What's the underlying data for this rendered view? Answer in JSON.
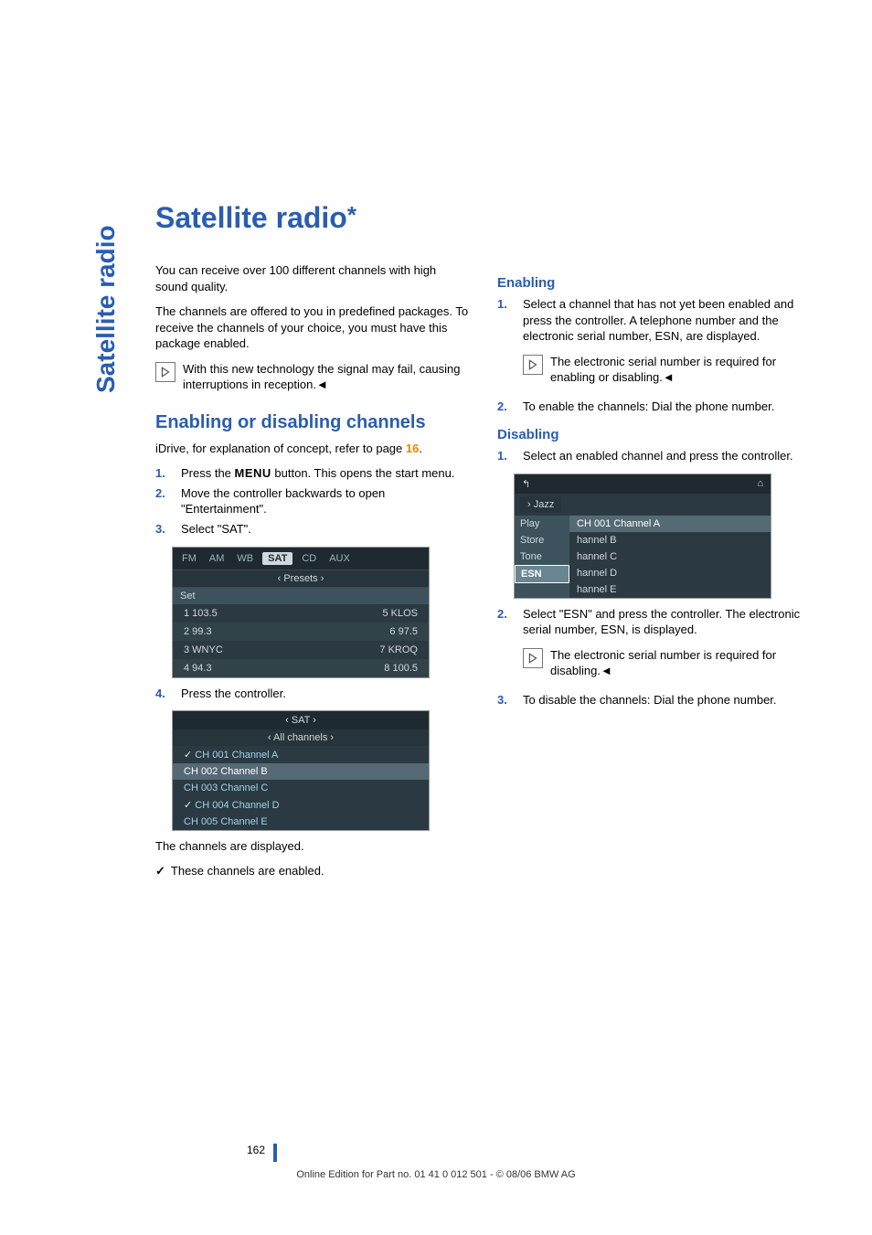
{
  "side_tab": "Satellite radio",
  "title": "Satellite radio",
  "title_suffix": "*",
  "left": {
    "intro1": "You can receive over 100 different channels with high sound quality.",
    "intro2": "The channels are offered to you in predefined packages. To receive the channels of your choice, you must have this package enabled.",
    "note1": "With this new technology the signal may fail, causing interruptions in reception.",
    "section_title": "Enabling or disabling channels",
    "idrive_text_a": "iDrive, for explanation of concept, refer to page ",
    "idrive_ref": "16",
    "idrive_text_b": ".",
    "steps": [
      {
        "num": "1.",
        "text_a": "Press the ",
        "menu": "MENU",
        "text_b": " button. This opens the start menu."
      },
      {
        "num": "2.",
        "text_a": "Move the controller backwards to open \"Entertainment\"."
      },
      {
        "num": "3.",
        "text_a": "Select \"SAT\"."
      }
    ],
    "ss1": {
      "tabs": [
        "FM",
        "AM",
        "WB",
        "SAT",
        "CD",
        "AUX"
      ],
      "presets_label": "‹ Presets ›",
      "set_label": "Set",
      "cells": [
        [
          "1 103.5",
          "5 KLOS"
        ],
        [
          "2 99.3",
          "6 97.5"
        ],
        [
          "3 WNYC",
          "7 KROQ"
        ],
        [
          "4 94.3",
          "8 100.5"
        ]
      ]
    },
    "step4": {
      "num": "4.",
      "text": "Press the controller."
    },
    "ss2": {
      "head": "‹  SAT  ›",
      "sub": "‹ All channels ›",
      "items": [
        {
          "label": "CH 001 Channel A",
          "chk": true
        },
        {
          "label": "CH 002 Channel B",
          "sel": true
        },
        {
          "label": "CH 003 Channel C"
        },
        {
          "label": "CH 004 Channel D",
          "chk": true
        },
        {
          "label": "CH 005 Channel E"
        }
      ]
    },
    "displayed_text": "The channels are displayed.",
    "enabled_text": "These channels are enabled."
  },
  "right": {
    "enabling_title": "Enabling",
    "en_steps": [
      {
        "num": "1.",
        "text": "Select a channel that has not yet been enabled and press the controller. A telephone number and the electronic serial number, ESN, are displayed."
      }
    ],
    "en_note": "The electronic serial number is required for enabling or disabling.",
    "en_step2": {
      "num": "2.",
      "text": "To enable the channels: Dial the phone number."
    },
    "disabling_title": "Disabling",
    "dis_step1": {
      "num": "1.",
      "text": "Select an enabled channel and press the controller."
    },
    "ss3": {
      "category": "› Jazz",
      "menu": [
        "Play",
        "Store",
        "Tone",
        "ESN"
      ],
      "rows": [
        {
          "label": "CH 001 Channel A",
          "hi": true,
          "chk": true
        },
        {
          "label": "hannel B"
        },
        {
          "label": "hannel C"
        },
        {
          "label": "hannel D"
        },
        {
          "label": "hannel E"
        }
      ]
    },
    "dis_step2": {
      "num": "2.",
      "text": "Select \"ESN\" and press the controller. The electronic serial number, ESN, is displayed."
    },
    "dis_note": "The electronic serial number is required for disabling.",
    "dis_step3": {
      "num": "3.",
      "text": "To disable the channels: Dial the phone number."
    }
  },
  "end_mark": "◄",
  "page_number": "162",
  "footer": "Online Edition for Part no. 01 41 0 012 501 - © 08/06 BMW AG"
}
